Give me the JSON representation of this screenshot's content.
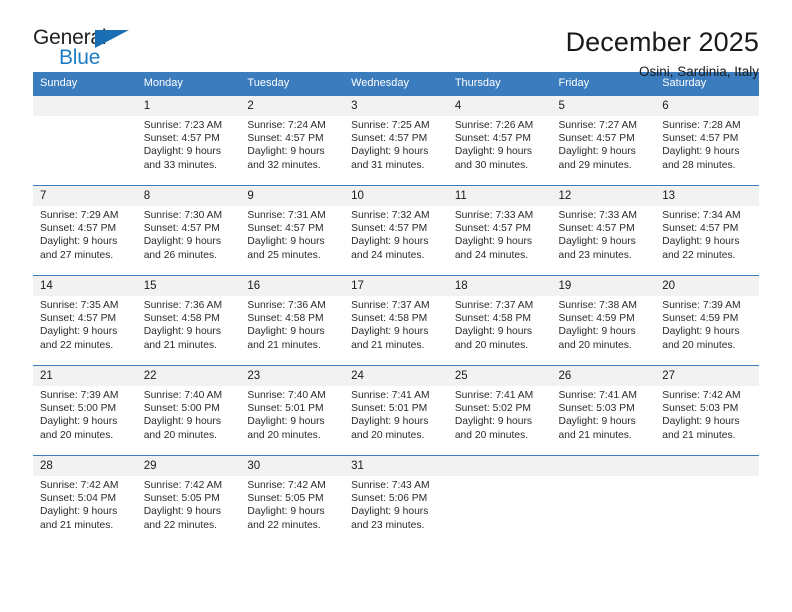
{
  "brand": {
    "name_top": "General",
    "name_bottom": "Blue",
    "accent_color": "#1a6fb4",
    "text_color": "#231f20"
  },
  "header": {
    "title": "December 2025",
    "subtitle": "Osini, Sardinia, Italy"
  },
  "calendar": {
    "header_bg": "#3b7cbe",
    "daynum_bg": "#f2f2f2",
    "weekdays": [
      "Sunday",
      "Monday",
      "Tuesday",
      "Wednesday",
      "Thursday",
      "Friday",
      "Saturday"
    ],
    "weeks": [
      [
        {
          "day": "",
          "sunrise": "",
          "sunset": "",
          "daylight1": "",
          "daylight2": ""
        },
        {
          "day": "1",
          "sunrise": "Sunrise: 7:23 AM",
          "sunset": "Sunset: 4:57 PM",
          "daylight1": "Daylight: 9 hours",
          "daylight2": "and 33 minutes."
        },
        {
          "day": "2",
          "sunrise": "Sunrise: 7:24 AM",
          "sunset": "Sunset: 4:57 PM",
          "daylight1": "Daylight: 9 hours",
          "daylight2": "and 32 minutes."
        },
        {
          "day": "3",
          "sunrise": "Sunrise: 7:25 AM",
          "sunset": "Sunset: 4:57 PM",
          "daylight1": "Daylight: 9 hours",
          "daylight2": "and 31 minutes."
        },
        {
          "day": "4",
          "sunrise": "Sunrise: 7:26 AM",
          "sunset": "Sunset: 4:57 PM",
          "daylight1": "Daylight: 9 hours",
          "daylight2": "and 30 minutes."
        },
        {
          "day": "5",
          "sunrise": "Sunrise: 7:27 AM",
          "sunset": "Sunset: 4:57 PM",
          "daylight1": "Daylight: 9 hours",
          "daylight2": "and 29 minutes."
        },
        {
          "day": "6",
          "sunrise": "Sunrise: 7:28 AM",
          "sunset": "Sunset: 4:57 PM",
          "daylight1": "Daylight: 9 hours",
          "daylight2": "and 28 minutes."
        }
      ],
      [
        {
          "day": "7",
          "sunrise": "Sunrise: 7:29 AM",
          "sunset": "Sunset: 4:57 PM",
          "daylight1": "Daylight: 9 hours",
          "daylight2": "and 27 minutes."
        },
        {
          "day": "8",
          "sunrise": "Sunrise: 7:30 AM",
          "sunset": "Sunset: 4:57 PM",
          "daylight1": "Daylight: 9 hours",
          "daylight2": "and 26 minutes."
        },
        {
          "day": "9",
          "sunrise": "Sunrise: 7:31 AM",
          "sunset": "Sunset: 4:57 PM",
          "daylight1": "Daylight: 9 hours",
          "daylight2": "and 25 minutes."
        },
        {
          "day": "10",
          "sunrise": "Sunrise: 7:32 AM",
          "sunset": "Sunset: 4:57 PM",
          "daylight1": "Daylight: 9 hours",
          "daylight2": "and 24 minutes."
        },
        {
          "day": "11",
          "sunrise": "Sunrise: 7:33 AM",
          "sunset": "Sunset: 4:57 PM",
          "daylight1": "Daylight: 9 hours",
          "daylight2": "and 24 minutes."
        },
        {
          "day": "12",
          "sunrise": "Sunrise: 7:33 AM",
          "sunset": "Sunset: 4:57 PM",
          "daylight1": "Daylight: 9 hours",
          "daylight2": "and 23 minutes."
        },
        {
          "day": "13",
          "sunrise": "Sunrise: 7:34 AM",
          "sunset": "Sunset: 4:57 PM",
          "daylight1": "Daylight: 9 hours",
          "daylight2": "and 22 minutes."
        }
      ],
      [
        {
          "day": "14",
          "sunrise": "Sunrise: 7:35 AM",
          "sunset": "Sunset: 4:57 PM",
          "daylight1": "Daylight: 9 hours",
          "daylight2": "and 22 minutes."
        },
        {
          "day": "15",
          "sunrise": "Sunrise: 7:36 AM",
          "sunset": "Sunset: 4:58 PM",
          "daylight1": "Daylight: 9 hours",
          "daylight2": "and 21 minutes."
        },
        {
          "day": "16",
          "sunrise": "Sunrise: 7:36 AM",
          "sunset": "Sunset: 4:58 PM",
          "daylight1": "Daylight: 9 hours",
          "daylight2": "and 21 minutes."
        },
        {
          "day": "17",
          "sunrise": "Sunrise: 7:37 AM",
          "sunset": "Sunset: 4:58 PM",
          "daylight1": "Daylight: 9 hours",
          "daylight2": "and 21 minutes."
        },
        {
          "day": "18",
          "sunrise": "Sunrise: 7:37 AM",
          "sunset": "Sunset: 4:58 PM",
          "daylight1": "Daylight: 9 hours",
          "daylight2": "and 20 minutes."
        },
        {
          "day": "19",
          "sunrise": "Sunrise: 7:38 AM",
          "sunset": "Sunset: 4:59 PM",
          "daylight1": "Daylight: 9 hours",
          "daylight2": "and 20 minutes."
        },
        {
          "day": "20",
          "sunrise": "Sunrise: 7:39 AM",
          "sunset": "Sunset: 4:59 PM",
          "daylight1": "Daylight: 9 hours",
          "daylight2": "and 20 minutes."
        }
      ],
      [
        {
          "day": "21",
          "sunrise": "Sunrise: 7:39 AM",
          "sunset": "Sunset: 5:00 PM",
          "daylight1": "Daylight: 9 hours",
          "daylight2": "and 20 minutes."
        },
        {
          "day": "22",
          "sunrise": "Sunrise: 7:40 AM",
          "sunset": "Sunset: 5:00 PM",
          "daylight1": "Daylight: 9 hours",
          "daylight2": "and 20 minutes."
        },
        {
          "day": "23",
          "sunrise": "Sunrise: 7:40 AM",
          "sunset": "Sunset: 5:01 PM",
          "daylight1": "Daylight: 9 hours",
          "daylight2": "and 20 minutes."
        },
        {
          "day": "24",
          "sunrise": "Sunrise: 7:41 AM",
          "sunset": "Sunset: 5:01 PM",
          "daylight1": "Daylight: 9 hours",
          "daylight2": "and 20 minutes."
        },
        {
          "day": "25",
          "sunrise": "Sunrise: 7:41 AM",
          "sunset": "Sunset: 5:02 PM",
          "daylight1": "Daylight: 9 hours",
          "daylight2": "and 20 minutes."
        },
        {
          "day": "26",
          "sunrise": "Sunrise: 7:41 AM",
          "sunset": "Sunset: 5:03 PM",
          "daylight1": "Daylight: 9 hours",
          "daylight2": "and 21 minutes."
        },
        {
          "day": "27",
          "sunrise": "Sunrise: 7:42 AM",
          "sunset": "Sunset: 5:03 PM",
          "daylight1": "Daylight: 9 hours",
          "daylight2": "and 21 minutes."
        }
      ],
      [
        {
          "day": "28",
          "sunrise": "Sunrise: 7:42 AM",
          "sunset": "Sunset: 5:04 PM",
          "daylight1": "Daylight: 9 hours",
          "daylight2": "and 21 minutes."
        },
        {
          "day": "29",
          "sunrise": "Sunrise: 7:42 AM",
          "sunset": "Sunset: 5:05 PM",
          "daylight1": "Daylight: 9 hours",
          "daylight2": "and 22 minutes."
        },
        {
          "day": "30",
          "sunrise": "Sunrise: 7:42 AM",
          "sunset": "Sunset: 5:05 PM",
          "daylight1": "Daylight: 9 hours",
          "daylight2": "and 22 minutes."
        },
        {
          "day": "31",
          "sunrise": "Sunrise: 7:43 AM",
          "sunset": "Sunset: 5:06 PM",
          "daylight1": "Daylight: 9 hours",
          "daylight2": "and 23 minutes."
        },
        {
          "day": "",
          "sunrise": "",
          "sunset": "",
          "daylight1": "",
          "daylight2": ""
        },
        {
          "day": "",
          "sunrise": "",
          "sunset": "",
          "daylight1": "",
          "daylight2": ""
        },
        {
          "day": "",
          "sunrise": "",
          "sunset": "",
          "daylight1": "",
          "daylight2": ""
        }
      ]
    ]
  }
}
